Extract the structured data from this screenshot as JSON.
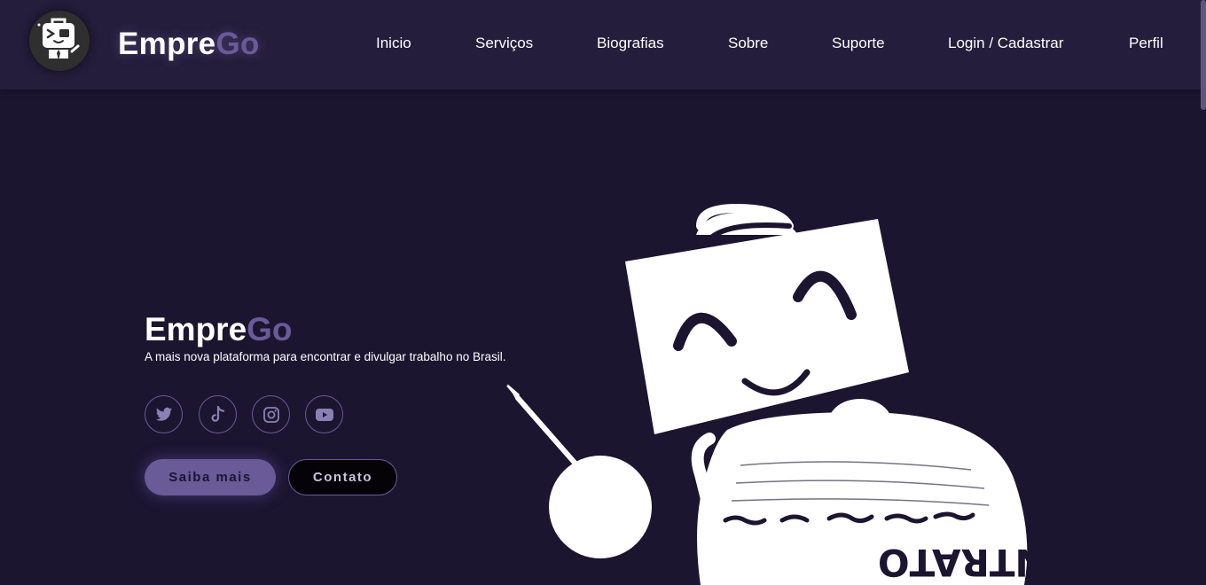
{
  "header": {
    "brand_prefix": "Empre",
    "brand_suffix": "Go",
    "nav": [
      {
        "label": "Inicio"
      },
      {
        "label": "Serviços"
      },
      {
        "label": "Biografias"
      },
      {
        "label": "Sobre"
      },
      {
        "label": "Suporte"
      },
      {
        "label": "Login / Cadastrar"
      },
      {
        "label": "Perfil"
      }
    ]
  },
  "hero": {
    "title_prefix": "Empre",
    "title_suffix": "Go",
    "subtitle": "A mais nova plataforma para encontrar e divulgar trabalho no Brasil.",
    "socials": [
      {
        "icon": "twitter-icon"
      },
      {
        "icon": "tiktok-icon"
      },
      {
        "icon": "instagram-icon"
      },
      {
        "icon": "youtube-icon"
      }
    ],
    "primary_button": "Saiba mais",
    "secondary_button": "Contato"
  },
  "illustration": {
    "contract_text": "CONTRATO"
  },
  "colors": {
    "background": "#1b1530",
    "header": "#241d3b",
    "accent": "#6a5a98",
    "text": "#ffffff"
  }
}
